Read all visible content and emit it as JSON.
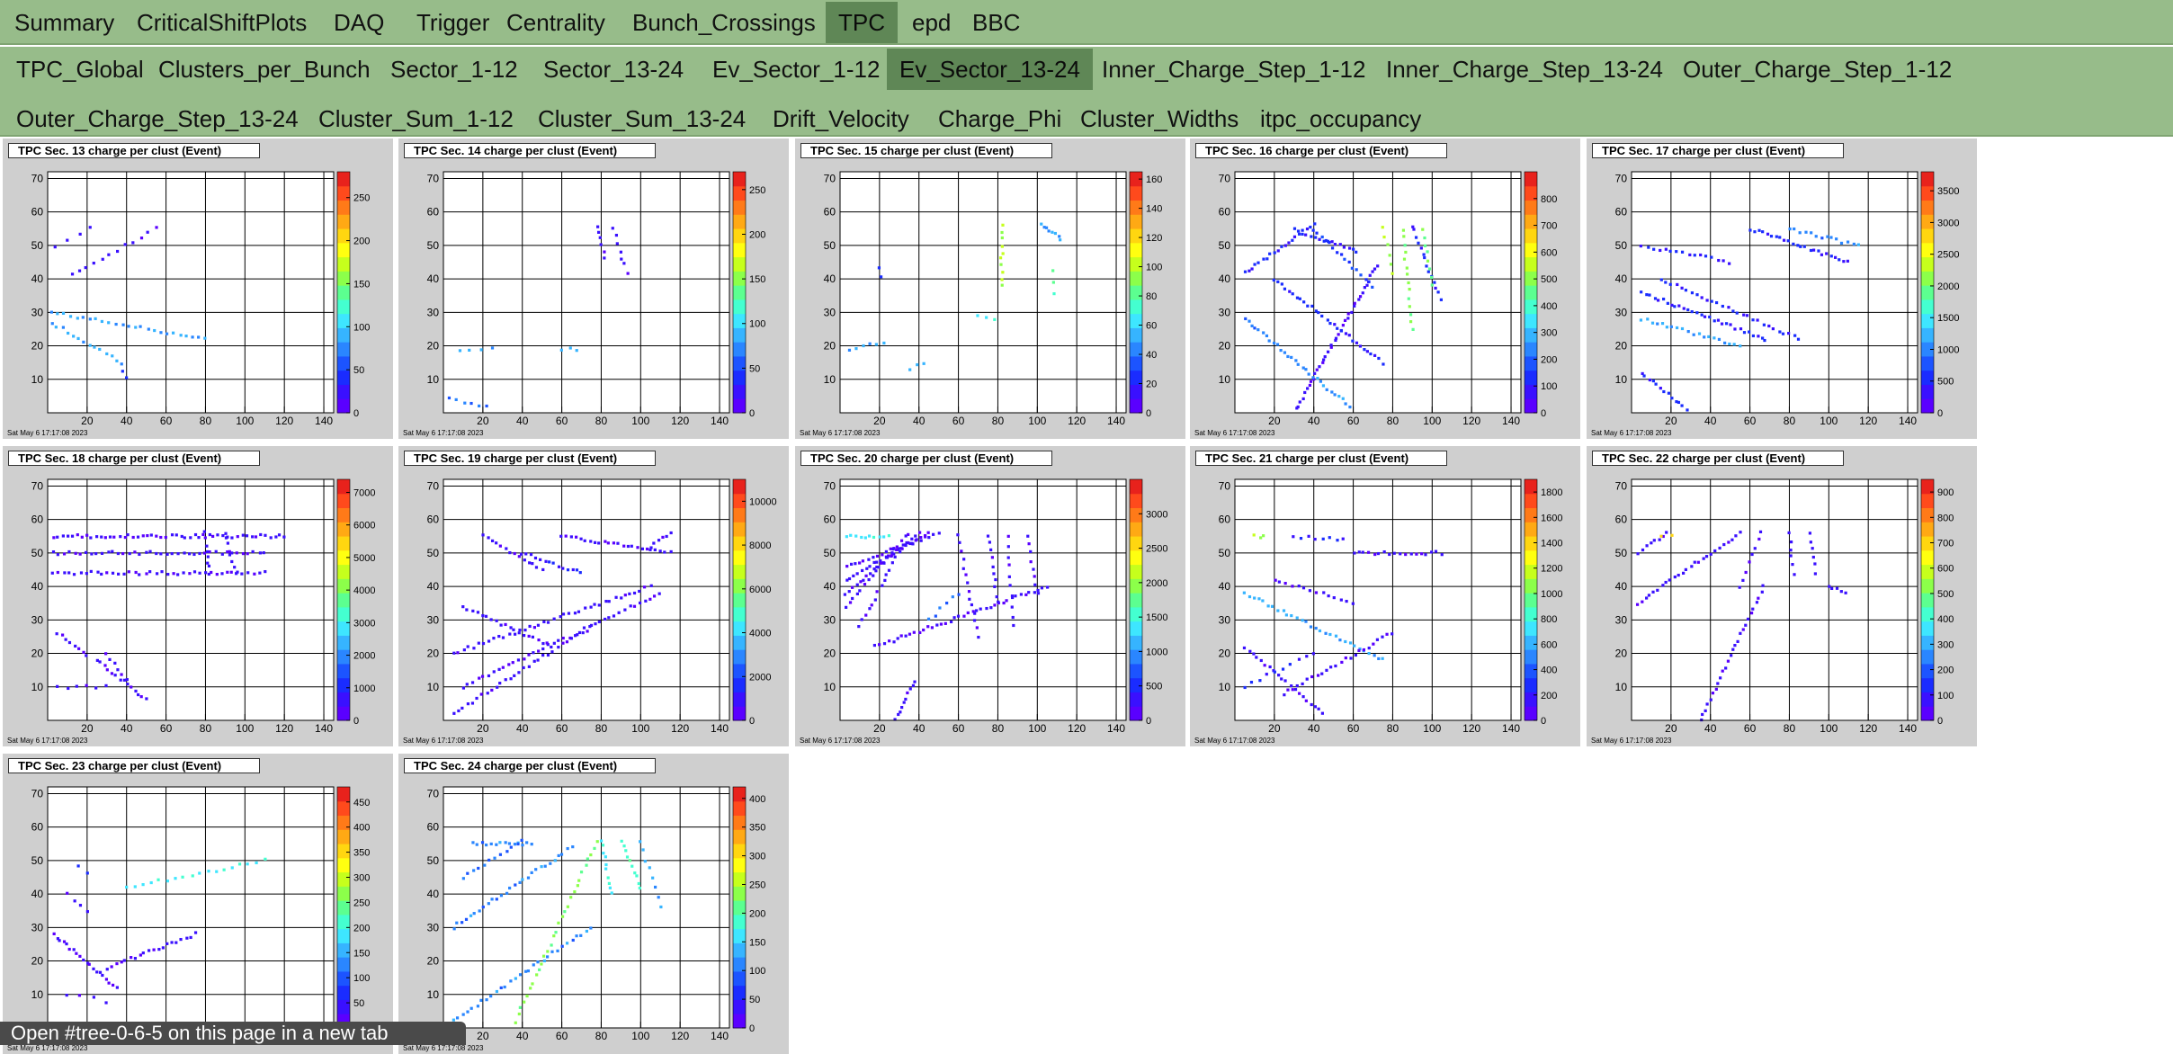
{
  "nav_main": [
    "Summary",
    "CriticalShiftPlots",
    "DAQ",
    "Trigger",
    "Centrality",
    "Bunch_Crossings",
    "TPC",
    "epd",
    "BBC"
  ],
  "nav_main_active": "TPC",
  "nav_sub": [
    "TPC_Global",
    "Clusters_per_Bunch",
    "Sector_1-12",
    "Sector_13-24",
    "Ev_Sector_1-12",
    "Ev_Sector_13-24",
    "Inner_Charge_Step_1-12",
    "Inner_Charge_Step_13-24",
    "Outer_Charge_Step_1-12",
    "Outer_Charge_Step_13-24",
    "Cluster_Sum_1-12",
    "Cluster_Sum_13-24",
    "Drift_Velocity",
    "Charge_Phi",
    "Cluster_Widths",
    "itpc_occupancy"
  ],
  "nav_sub_active": "Ev_Sector_13-24",
  "tooltip": "Open #tree-0-6-5 on this page in a new tab",
  "date": "Sat May 6 17:17:08 2023",
  "colors": {
    "nav": "#97bc8a",
    "nav_active": "#5f8756",
    "panel_bg": "#cfcfcf"
  },
  "chart_data": [
    {
      "type": "heatmap",
      "title": "TPC Sec. 13 charge per clust (Event)",
      "xlim": [
        0,
        145
      ],
      "ylim": [
        0,
        72
      ],
      "x_ticks": [
        20,
        40,
        60,
        80,
        100,
        120,
        140
      ],
      "y_ticks": [
        10,
        20,
        30,
        40,
        50,
        60,
        70
      ],
      "z_ticks": [
        0,
        50,
        100,
        150,
        200,
        250
      ],
      "zmax": 280,
      "tracks": [
        [
          2,
          30,
          80,
          22,
          25,
          0.3
        ],
        [
          12,
          41,
          55,
          55,
          12,
          0.05
        ],
        [
          2,
          27,
          38,
          15,
          14,
          0.3
        ],
        [
          4,
          50,
          22,
          55,
          4,
          0.05
        ],
        [
          38,
          12,
          40,
          10,
          2,
          0.1
        ]
      ]
    },
    {
      "type": "heatmap",
      "title": "TPC Sec. 14 charge per clust (Event)",
      "xlim": [
        0,
        145
      ],
      "ylim": [
        0,
        72
      ],
      "x_ticks": [
        20,
        40,
        60,
        80,
        100,
        120,
        140
      ],
      "y_ticks": [
        10,
        20,
        30,
        40,
        50,
        60,
        70
      ],
      "z_ticks": [
        0,
        50,
        100,
        150,
        200,
        250
      ],
      "zmax": 270,
      "tracks": [
        [
          78,
          56,
          82,
          46,
          6,
          0.05
        ],
        [
          86,
          55,
          93,
          42,
          7,
          0.05
        ],
        [
          3,
          4,
          22,
          2,
          6,
          0.2
        ],
        [
          8,
          19,
          25,
          19,
          4,
          0.3
        ],
        [
          60,
          19,
          68,
          19,
          3,
          0.3
        ]
      ]
    },
    {
      "type": "heatmap",
      "title": "TPC Sec. 15 charge per clust (Event)",
      "xlim": [
        0,
        145
      ],
      "ylim": [
        0,
        72
      ],
      "x_ticks": [
        20,
        40,
        60,
        80,
        100,
        120,
        140
      ],
      "y_ticks": [
        10,
        20,
        30,
        40,
        50,
        60,
        70
      ],
      "z_ticks": [
        0,
        20,
        40,
        60,
        80,
        100,
        120,
        140,
        160
      ],
      "zmax": 165,
      "tracks": [
        [
          82,
          56,
          82,
          38,
          10,
          0.6
        ],
        [
          102,
          56,
          112,
          52,
          8,
          0.3
        ],
        [
          108,
          42,
          109,
          36,
          3,
          0.5
        ],
        [
          5,
          19,
          22,
          21,
          6,
          0.3
        ],
        [
          36,
          13,
          42,
          15,
          3,
          0.3
        ],
        [
          20,
          43,
          21,
          41,
          2,
          0.1
        ],
        [
          70,
          29,
          78,
          28,
          3,
          0.4
        ]
      ]
    },
    {
      "type": "heatmap",
      "title": "TPC Sec. 16 charge per clust (Event)",
      "xlim": [
        0,
        145
      ],
      "ylim": [
        0,
        72
      ],
      "x_ticks": [
        20,
        40,
        60,
        80,
        100,
        120,
        140
      ],
      "y_ticks": [
        10,
        20,
        30,
        40,
        50,
        60,
        70
      ],
      "z_ticks": [
        0,
        100,
        200,
        300,
        400,
        500,
        600,
        700,
        800
      ],
      "zmax": 900,
      "tracks": [
        [
          30,
          0,
          72,
          44,
          40,
          0.05
        ],
        [
          5,
          28,
          58,
          2,
          30,
          0.25
        ],
        [
          20,
          40,
          75,
          15,
          30,
          0.1
        ],
        [
          5,
          42,
          40,
          56,
          20,
          0.1
        ],
        [
          40,
          55,
          70,
          38,
          16,
          0.15
        ],
        [
          90,
          56,
          104,
          34,
          14,
          0.1
        ],
        [
          85,
          55,
          90,
          25,
          14,
          0.55
        ],
        [
          30,
          55,
          62,
          48,
          16,
          0.1
        ],
        [
          75,
          55,
          80,
          42,
          6,
          0.6
        ],
        [
          95,
          55,
          100,
          38,
          8,
          0.5
        ]
      ]
    },
    {
      "type": "heatmap",
      "title": "TPC Sec. 17 charge per clust (Event)",
      "xlim": [
        0,
        145
      ],
      "ylim": [
        0,
        72
      ],
      "x_ticks": [
        20,
        40,
        60,
        80,
        100,
        120,
        140
      ],
      "y_ticks": [
        10,
        20,
        30,
        40,
        50,
        60,
        70
      ],
      "z_ticks": [
        0,
        500,
        1000,
        1500,
        2000,
        2500,
        3000,
        3500
      ],
      "zmax": 3800,
      "tracks": [
        [
          5,
          36,
          68,
          22,
          30,
          0.1
        ],
        [
          15,
          40,
          85,
          22,
          28,
          0.1
        ],
        [
          60,
          55,
          110,
          45,
          24,
          0.1
        ],
        [
          5,
          50,
          50,
          45,
          16,
          0.1
        ],
        [
          5,
          12,
          30,
          0,
          14,
          0.1
        ],
        [
          5,
          28,
          55,
          20,
          20,
          0.3
        ],
        [
          80,
          55,
          115,
          50,
          14,
          0.25
        ]
      ]
    },
    {
      "type": "heatmap",
      "title": "TPC Sec. 18 charge per clust (Event)",
      "xlim": [
        0,
        145
      ],
      "ylim": [
        0,
        72
      ],
      "x_ticks": [
        20,
        40,
        60,
        80,
        100,
        120,
        140
      ],
      "y_ticks": [
        10,
        20,
        30,
        40,
        50,
        60,
        70
      ],
      "z_ticks": [
        0,
        1000,
        2000,
        3000,
        4000,
        5000,
        6000,
        7000
      ],
      "zmax": 7400,
      "tracks": [
        [
          3,
          55,
          120,
          55,
          50,
          0.05
        ],
        [
          3,
          50,
          110,
          50,
          40,
          0.05
        ],
        [
          3,
          44,
          110,
          44,
          40,
          0.05
        ],
        [
          80,
          56,
          82,
          44,
          8,
          0.05
        ],
        [
          90,
          56,
          95,
          44,
          8,
          0.05
        ],
        [
          5,
          26,
          20,
          19,
          8,
          0.05
        ],
        [
          25,
          18,
          50,
          6,
          14,
          0.05
        ],
        [
          5,
          10,
          30,
          10,
          6,
          0.05
        ],
        [
          30,
          20,
          40,
          12,
          6,
          0.05
        ]
      ]
    },
    {
      "type": "heatmap",
      "title": "TPC Sec. 19 charge per clust (Event)",
      "xlim": [
        0,
        145
      ],
      "ylim": [
        0,
        72
      ],
      "x_ticks": [
        20,
        40,
        60,
        80,
        100,
        120,
        140
      ],
      "y_ticks": [
        10,
        20,
        30,
        40,
        50,
        60,
        70
      ],
      "z_ticks": [
        0,
        2000,
        4000,
        6000,
        8000,
        10000
      ],
      "zmax": 11000,
      "tracks": [
        [
          5,
          20,
          105,
          40,
          40,
          0.05
        ],
        [
          10,
          10,
          110,
          38,
          40,
          0.05
        ],
        [
          5,
          2,
          75,
          28,
          30,
          0.05
        ],
        [
          10,
          34,
          55,
          22,
          20,
          0.05
        ],
        [
          20,
          55,
          50,
          45,
          14,
          0.05
        ],
        [
          60,
          55,
          115,
          50,
          24,
          0.05
        ],
        [
          40,
          50,
          70,
          44,
          14,
          0.1
        ],
        [
          105,
          52,
          115,
          56,
          6,
          0.05
        ]
      ]
    },
    {
      "type": "heatmap",
      "title": "TPC Sec. 20 charge per clust (Event)",
      "xlim": [
        0,
        145
      ],
      "ylim": [
        0,
        72
      ],
      "x_ticks": [
        20,
        40,
        60,
        80,
        100,
        120,
        140
      ],
      "y_ticks": [
        10,
        20,
        30,
        40,
        50,
        60,
        70
      ],
      "z_ticks": [
        0,
        500,
        1000,
        1500,
        2000,
        2500,
        3000
      ],
      "zmax": 3500,
      "tracks": [
        [
          3,
          38,
          40,
          56,
          22,
          0.05
        ],
        [
          3,
          42,
          45,
          56,
          22,
          0.05
        ],
        [
          3,
          46,
          50,
          56,
          22,
          0.05
        ],
        [
          3,
          34,
          35,
          56,
          18,
          0.05
        ],
        [
          10,
          28,
          30,
          50,
          14,
          0.05
        ],
        [
          18,
          22,
          105,
          40,
          40,
          0.05
        ],
        [
          60,
          55,
          70,
          25,
          14,
          0.05
        ],
        [
          75,
          55,
          80,
          35,
          10,
          0.05
        ],
        [
          85,
          55,
          88,
          28,
          10,
          0.05
        ],
        [
          95,
          55,
          100,
          38,
          8,
          0.05
        ],
        [
          28,
          0,
          38,
          12,
          10,
          0.05
        ],
        [
          3,
          55,
          25,
          55,
          10,
          0.4
        ],
        [
          45,
          30,
          60,
          38,
          6,
          0.2
        ]
      ]
    },
    {
      "type": "heatmap",
      "title": "TPC Sec. 21 charge per clust (Event)",
      "xlim": [
        0,
        145
      ],
      "ylim": [
        0,
        72
      ],
      "x_ticks": [
        20,
        40,
        60,
        80,
        100,
        120,
        140
      ],
      "y_ticks": [
        10,
        20,
        30,
        40,
        50,
        60,
        70
      ],
      "z_ticks": [
        0,
        200,
        400,
        600,
        800,
        1000,
        1200,
        1400,
        1600,
        1800
      ],
      "zmax": 1900,
      "tracks": [
        [
          5,
          38,
          75,
          18,
          30,
          0.3
        ],
        [
          5,
          22,
          45,
          2,
          20,
          0.05
        ],
        [
          25,
          8,
          80,
          26,
          24,
          0.05
        ],
        [
          60,
          50,
          105,
          50,
          18,
          0.05
        ],
        [
          20,
          42,
          60,
          35,
          14,
          0.05
        ],
        [
          5,
          10,
          40,
          20,
          10,
          0.1
        ],
        [
          30,
          55,
          55,
          54,
          8,
          0.1
        ],
        [
          10,
          55,
          15,
          55,
          3,
          0.6
        ]
      ]
    },
    {
      "type": "heatmap",
      "title": "TPC Sec. 22 charge per clust (Event)",
      "xlim": [
        0,
        145
      ],
      "ylim": [
        0,
        72
      ],
      "x_ticks": [
        20,
        40,
        60,
        80,
        100,
        120,
        140
      ],
      "y_ticks": [
        10,
        20,
        30,
        40,
        50,
        60,
        70
      ],
      "z_ticks": [
        0,
        100,
        200,
        300,
        400,
        500,
        600,
        700,
        800,
        900
      ],
      "zmax": 950,
      "tracks": [
        [
          3,
          35,
          55,
          56,
          26,
          0.05
        ],
        [
          3,
          50,
          18,
          56,
          8,
          0.05
        ],
        [
          35,
          0,
          67,
          40,
          26,
          0.05
        ],
        [
          80,
          56,
          82,
          44,
          6,
          0.05
        ],
        [
          90,
          56,
          93,
          44,
          6,
          0.05
        ],
        [
          55,
          40,
          66,
          56,
          8,
          0.05
        ],
        [
          100,
          40,
          108,
          38,
          5,
          0.05
        ],
        [
          15,
          55,
          20,
          55,
          2,
          0.8
        ]
      ]
    },
    {
      "type": "heatmap",
      "title": "TPC Sec. 23 charge per clust (Event)",
      "xlim": [
        0,
        145
      ],
      "ylim": [
        0,
        72
      ],
      "x_ticks": [
        20,
        40,
        60,
        80,
        100,
        120,
        140
      ],
      "y_ticks": [
        10,
        20,
        30,
        40,
        50,
        60,
        70
      ],
      "z_ticks": [
        0,
        50,
        100,
        150,
        200,
        250,
        300,
        350,
        400,
        450
      ],
      "zmax": 480,
      "tracks": [
        [
          3,
          28,
          35,
          12,
          20,
          0.05
        ],
        [
          30,
          18,
          75,
          28,
          20,
          0.05
        ],
        [
          40,
          42,
          110,
          50,
          18,
          0.4
        ],
        [
          10,
          40,
          20,
          35,
          4,
          0.05
        ],
        [
          15,
          48,
          20,
          46,
          2,
          0.1
        ],
        [
          10,
          10,
          30,
          8,
          4,
          0.05
        ]
      ]
    },
    {
      "type": "heatmap",
      "title": "TPC Sec. 24 charge per clust (Event)",
      "xlim": [
        0,
        145
      ],
      "ylim": [
        0,
        72
      ],
      "x_ticks": [
        20,
        40,
        60,
        80,
        100,
        120,
        140
      ],
      "y_ticks": [
        10,
        20,
        30,
        40,
        50,
        60,
        70
      ],
      "z_ticks": [
        0,
        50,
        100,
        150,
        200,
        250,
        300,
        350,
        400
      ],
      "zmax": 420,
      "tracks": [
        [
          5,
          30,
          65,
          54,
          28,
          0.25
        ],
        [
          35,
          0,
          78,
          56,
          30,
          0.55
        ],
        [
          5,
          2,
          75,
          30,
          30,
          0.25
        ],
        [
          80,
          56,
          85,
          40,
          10,
          0.4
        ],
        [
          90,
          56,
          100,
          42,
          10,
          0.45
        ],
        [
          15,
          55,
          45,
          55,
          14,
          0.25
        ],
        [
          100,
          56,
          110,
          36,
          8,
          0.3
        ],
        [
          10,
          45,
          40,
          56,
          12,
          0.2
        ]
      ]
    }
  ]
}
